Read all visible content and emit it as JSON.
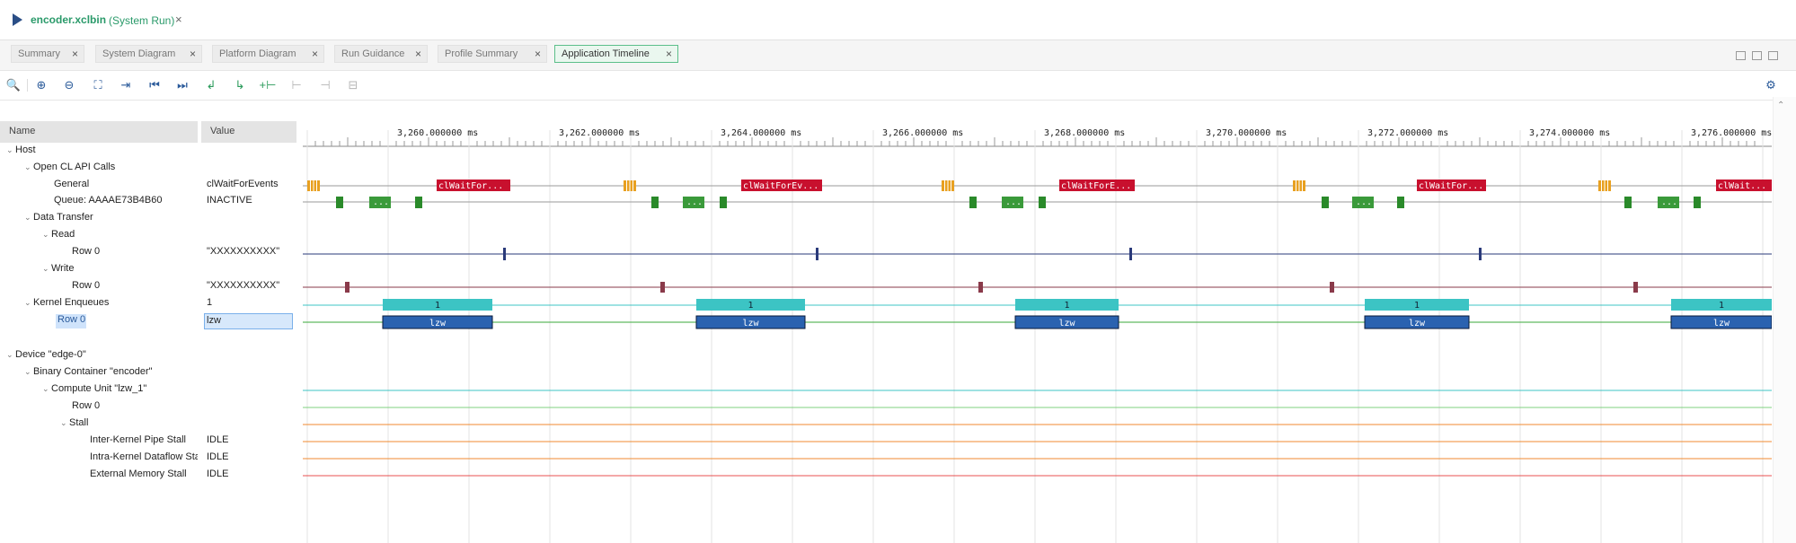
{
  "title": {
    "file": "encoder.xclbin",
    "subtitle": "(System Run)",
    "close": "×"
  },
  "tabs": [
    {
      "label": "Summary",
      "close": "×"
    },
    {
      "label": "System Diagram",
      "close": "×"
    },
    {
      "label": "Platform Diagram",
      "close": "×"
    },
    {
      "label": "Run Guidance",
      "close": "×"
    },
    {
      "label": "Profile Summary",
      "close": "×"
    },
    {
      "label": "Application Timeline",
      "close": "×"
    }
  ],
  "toolbar": {
    "icons": [
      "search-icon",
      "zoom-in-icon",
      "zoom-out-icon",
      "zoom-fit-icon",
      "add-marker-icon",
      "go-to-start-icon",
      "go-to-end-icon",
      "previous-transition-icon",
      "next-transition-icon",
      "add-cursor-icon",
      "remove-cursor-icon",
      "prev-marker-icon",
      "next-marker-icon"
    ],
    "glyphs": [
      "🔍",
      "⊕",
      "⊖",
      "⛶",
      "⇥",
      "⏮",
      "⏭",
      "↲",
      "↳",
      "+⊢",
      "⊢",
      "⊣",
      "⊟"
    ],
    "settings_icon": "⚙"
  },
  "columns": {
    "name": "Name",
    "value": "Value"
  },
  "tree": [
    {
      "label": "Host",
      "value": "",
      "caret": "⌄"
    },
    {
      "label": "Open CL API Calls",
      "value": "",
      "caret": "⌄"
    },
    {
      "label": "General",
      "value": "clWaitForEvents",
      "caret": ""
    },
    {
      "label": "Queue: AAAAE73B4B60",
      "value": "INACTIVE",
      "caret": ""
    },
    {
      "label": "Data Transfer",
      "value": "",
      "caret": "⌄"
    },
    {
      "label": "Read",
      "value": "",
      "caret": "⌄"
    },
    {
      "label": "Row 0",
      "value": "\"XXXXXXXXXX\"",
      "caret": ""
    },
    {
      "label": "Write",
      "value": "",
      "caret": "⌄"
    },
    {
      "label": "Row 0",
      "value": "\"XXXXXXXXXX\"",
      "caret": ""
    },
    {
      "label": "Kernel Enqueues",
      "value": "1",
      "caret": "⌄"
    },
    {
      "label": "Row 0",
      "value": "lzw",
      "caret": ""
    },
    {
      "label": "Device \"edge-0\"",
      "value": "",
      "caret": "⌄"
    },
    {
      "label": "Binary Container \"encoder\"",
      "value": "",
      "caret": "⌄"
    },
    {
      "label": "Compute Unit \"lzw_1\"",
      "value": "",
      "caret": "⌄"
    },
    {
      "label": "Row 0",
      "value": "",
      "caret": ""
    },
    {
      "label": "Stall",
      "value": "",
      "caret": "⌄"
    },
    {
      "label": "Inter-Kernel Pipe Stall",
      "value": "IDLE",
      "caret": ""
    },
    {
      "label": "Intra-Kernel Dataflow Sta",
      "value": "IDLE",
      "caret": ""
    },
    {
      "label": "External Memory Stall",
      "value": "IDLE",
      "caret": ""
    }
  ],
  "timeline": {
    "time_labels": [
      "3,260.000000 ms",
      "3,262.000000 ms",
      "3,264.000000 ms",
      "3,266.000000 ms",
      "3,268.000000 ms",
      "3,270.000000 ms",
      "3,272.000000 ms",
      "3,274.000000 ms",
      "3,276.000000 ms"
    ],
    "general_labels": [
      "clWaitFor...",
      "clWaitForEv...",
      "clWaitForE...",
      "clWaitFor...",
      "clWait..."
    ],
    "queue_label": "...",
    "kernel_count_label": "1",
    "kernel_name_label": "lzw",
    "colors": {
      "api_call": "#c8102e",
      "api_small": "#e8a020",
      "queue": "#3a9a3a",
      "read": "#2a3a7a",
      "write": "#8a3a4a",
      "kernel_enq": "#3cc4c4",
      "kernel_exec": "#2a62b0",
      "kernel_line": "#3aaa3a",
      "cu_row": "#7fd17f",
      "stall": "#f08a30",
      "ext_mem": "#e85050",
      "track": "#9a9a9a"
    }
  }
}
